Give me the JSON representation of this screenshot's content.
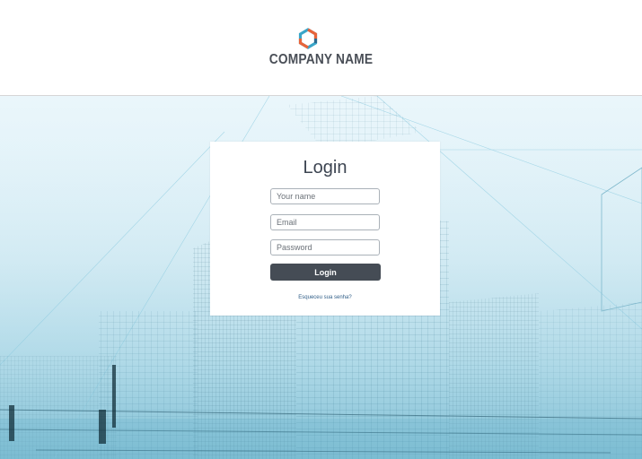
{
  "header": {
    "logo_icon": "hexagon-logo-icon",
    "brand_name": "COMPANY NAME",
    "logo_colors": [
      "#e8643a",
      "#3aa6c9",
      "#2b6a8f"
    ]
  },
  "login": {
    "title": "Login",
    "name_placeholder": "Your name",
    "email_placeholder": "Email",
    "password_placeholder": "Password",
    "submit_label": "Login",
    "forgot_link": "Esqueceu sua senha?"
  },
  "colors": {
    "button": "#454c55",
    "title": "#3d4552",
    "hero_tint": "#bfe3ef"
  }
}
